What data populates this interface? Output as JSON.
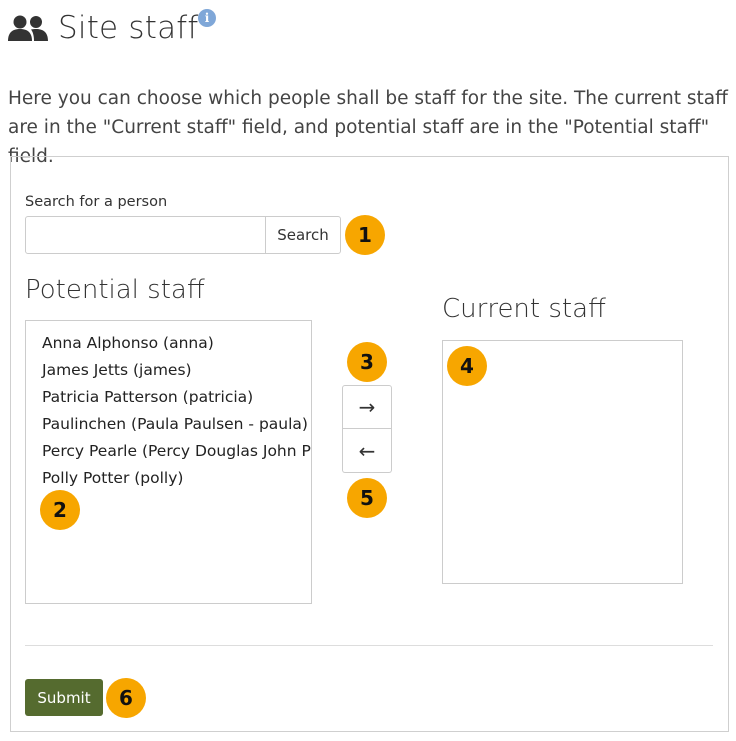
{
  "header": {
    "title": "Site staff",
    "icon": "users-icon",
    "info_icon": "info-icon",
    "info_glyph": "i"
  },
  "description": "Here you can choose which people shall be staff for the site. The current staff are in the \"Current staff\" field, and potential staff are in the \"Potential staff\" field.",
  "search": {
    "label": "Search for a person",
    "value": "",
    "placeholder": "",
    "button_label": "Search"
  },
  "potential": {
    "heading": "Potential staff",
    "items": [
      "Anna Alphonso (anna)",
      "James Jetts (james)",
      "Patricia Patterson (patricia)",
      "Paulinchen (Paula Paulsen - paula)",
      "Percy Pearle (Percy Douglas John P",
      "Polly Potter (polly)"
    ]
  },
  "current": {
    "heading": "Current staff",
    "items": []
  },
  "move": {
    "right_glyph": "→",
    "left_glyph": "←"
  },
  "submit": {
    "label": "Submit"
  },
  "badges": [
    "1",
    "2",
    "3",
    "4",
    "5",
    "6"
  ],
  "colors": {
    "submit_bg": "#556b2f",
    "badge_bg": "#f7a600",
    "info_bg": "#7fa7d8"
  }
}
